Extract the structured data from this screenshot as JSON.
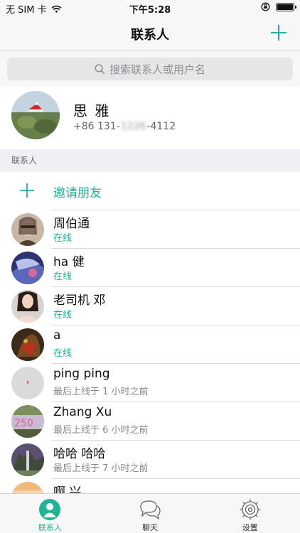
{
  "status_bar": {
    "carrier": "无 SIM 卡",
    "wifi_icon": "wifi-icon",
    "time": "下午5:28",
    "orientation_lock_icon": "orientation-lock-icon",
    "battery_icon": "battery-icon"
  },
  "nav": {
    "title": "联系人",
    "add_icon": "plus-icon"
  },
  "search": {
    "placeholder": "搜索联系人或用户名",
    "icon": "search-icon"
  },
  "profile": {
    "name": "思 雅",
    "phone_prefix": "+86 131-",
    "phone_hidden": "1226",
    "phone_suffix": "-4112"
  },
  "section": {
    "header": "联系人"
  },
  "invite": {
    "label": "邀请朋友",
    "icon": "plus-icon"
  },
  "contacts": [
    {
      "name": "周伯通",
      "status": "在线",
      "online": true
    },
    {
      "name": "ha 健",
      "status": "在线",
      "online": true
    },
    {
      "name": "老司机 邓",
      "status": "在线",
      "online": true
    },
    {
      "name": "a",
      "status": "在线",
      "online": true
    },
    {
      "name": "ping ping",
      "status": "最后上线于 1 小时之前",
      "online": false
    },
    {
      "name": "Zhang Xu",
      "status": "最后上线于 6 小时之前",
      "online": false
    },
    {
      "name": "哈哈 哈哈",
      "status": "最后上线于 7 小时之前",
      "online": false
    },
    {
      "name": "啊 兴",
      "status": "",
      "online": false
    }
  ],
  "tabs": [
    {
      "label": "联系人",
      "icon": "contacts-icon",
      "active": true
    },
    {
      "label": "聊天",
      "icon": "chat-bubbles-icon",
      "active": false
    },
    {
      "label": "设置",
      "icon": "settings-gear-icon",
      "active": false
    }
  ],
  "colors": {
    "accent": "#1fb496",
    "status_gray": "#888888",
    "background_gray": "#efeff4"
  }
}
